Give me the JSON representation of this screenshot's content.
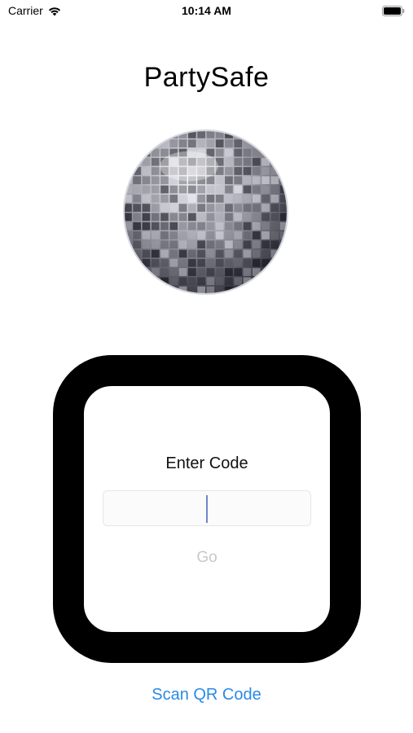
{
  "status_bar": {
    "carrier": "Carrier",
    "time": "10:14 AM",
    "icons": [
      "wifi-icon",
      "battery-icon"
    ]
  },
  "app": {
    "title": "PartySafe",
    "logo": "disco-ball-image"
  },
  "code_entry": {
    "label": "Enter Code",
    "input_value": "",
    "input_placeholder": "",
    "go_label": "Go"
  },
  "actions": {
    "scan_qr_label": "Scan QR Code"
  },
  "colors": {
    "link": "#2a8ae6",
    "disabled_text": "#c8c8c8",
    "frame": "#000000",
    "cursor": "#6e87c9"
  }
}
